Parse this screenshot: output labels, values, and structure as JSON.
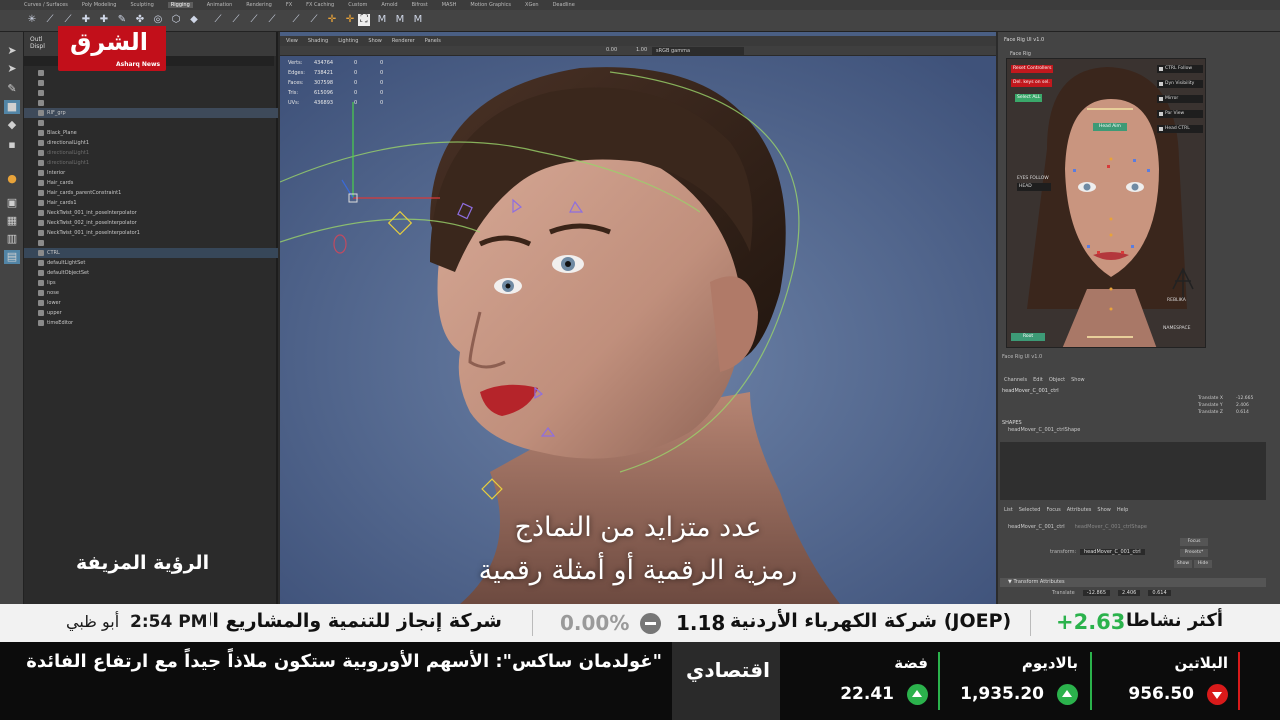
{
  "maya": {
    "shelf_tabs": [
      "Curves / Surfaces",
      "Poly Modeling",
      "Sculpting",
      "Rigging",
      "Animation",
      "Rendering",
      "FX",
      "FX Caching",
      "Custom",
      "Arnold",
      "Bifrost",
      "MASH",
      "Motion Graphics",
      "XGen",
      "Deadline"
    ],
    "active_shelf": "Rigging",
    "outliner": {
      "title": "Outl",
      "subtitle": "Displ",
      "items": [
        {
          "label": "",
          "dim": false
        },
        {
          "label": "",
          "dim": true
        },
        {
          "label": "",
          "dim": true
        },
        {
          "label": "",
          "dim": true
        },
        {
          "label": "RIF_grp",
          "dim": false,
          "sel": true
        },
        {
          "label": "",
          "dim": true
        },
        {
          "label": "Black_Plane",
          "dim": false
        },
        {
          "label": "directionalLight1",
          "dim": false
        },
        {
          "label": "directionalLight1",
          "dim": true
        },
        {
          "label": "directionalLight1",
          "dim": true
        },
        {
          "label": "Interior",
          "dim": false
        },
        {
          "label": "Hair_cards",
          "dim": false
        },
        {
          "label": "Hair_cards_parentConstraint1",
          "dim": false
        },
        {
          "label": "Hair_cards1",
          "dim": false
        },
        {
          "label": "NeckTwist_001_int_poseInterpolator",
          "dim": false
        },
        {
          "label": "NeckTwist_002_int_poseInterpolator",
          "dim": false
        },
        {
          "label": "NeckTwist_001_int_poseInterpolator1",
          "dim": false
        },
        {
          "label": "",
          "dim": true
        },
        {
          "label": "CTRL",
          "dim": false,
          "sel2": true
        },
        {
          "label": "defaultLightSet",
          "dim": false
        },
        {
          "label": "defaultObjectSet",
          "dim": false
        },
        {
          "label": "lips",
          "dim": false
        },
        {
          "label": "nose",
          "dim": false
        },
        {
          "label": "lower",
          "dim": false
        },
        {
          "label": "upper",
          "dim": false
        },
        {
          "label": "timeEditor",
          "dim": false
        }
      ]
    },
    "viewport": {
      "menu": [
        "View",
        "Shading",
        "Lighting",
        "Show",
        "Renderer",
        "Panels"
      ],
      "color_space": "sRGB gamma",
      "field_a": "0.00",
      "field_b": "1.00",
      "hud": [
        {
          "k": "Verts:",
          "v": "434764",
          "a": "0",
          "b": "0"
        },
        {
          "k": "Edges:",
          "v": "738421",
          "a": "0",
          "b": "0"
        },
        {
          "k": "Faces:",
          "v": "307598",
          "a": "0",
          "b": "0"
        },
        {
          "k": "Tris:",
          "v": "615096",
          "a": "0",
          "b": "0"
        },
        {
          "k": "UVs:",
          "v": "436893",
          "a": "0",
          "b": "0"
        }
      ]
    },
    "face_rig": {
      "title": "Face Rig UI v1.0",
      "subtitle": "Face Rig",
      "buttons": {
        "reset": "Reset Controllers",
        "del_keys": "Del. keys on sel.",
        "select_all": "Select ALL",
        "head_aim": "Head Aim",
        "root": "Root",
        "eyes_follow": "EYES FOLLOW",
        "eyes_target": "HEAD",
        "namespace": "NAMESPACE",
        "brand": "REBLIKA"
      },
      "checks": [
        "CTRL Follow",
        "Dyn Visibility",
        "Mirror",
        "Par View",
        "Head CTRL"
      ],
      "footer": "Face Rig UI v1.0"
    },
    "channel_box": {
      "menu": [
        "Channels",
        "Edit",
        "Object",
        "Show"
      ],
      "node": "headMover_C_001_ctrl",
      "attrs": [
        {
          "k": "Translate X",
          "v": "-12.665"
        },
        {
          "k": "Translate Y",
          "v": "2.406"
        },
        {
          "k": "Translate Z",
          "v": "0.614"
        }
      ],
      "shapes_label": "SHAPES",
      "shape_node": "headMover_C_001_ctrlShape"
    },
    "attr_editor": {
      "menu": [
        "List",
        "Selected",
        "Focus",
        "Attributes",
        "Show",
        "Help"
      ],
      "tabs": [
        "headMover_C_001_ctrl",
        "headMover_C_001_ctrlShape"
      ],
      "transform_label": "transform:",
      "transform_value": "headMover_C_001_ctrl",
      "focus": "Focus",
      "presets": "Presets*",
      "show": "Show",
      "hide": "Hide",
      "section": "Transform Attributes",
      "translate_label": "Translate",
      "translate": [
        "-12.865",
        "2.406",
        "0.614"
      ]
    }
  },
  "broadcast": {
    "logo_ar": "الشرق",
    "logo_en": "Asharq News",
    "watermark": "الرؤية المزيفة",
    "caption_line1": "عدد متزايد من النماذج",
    "caption_line2": "رمزية الرقمية أو أمثلة رقمية",
    "city": "أبو ظبي",
    "time": "2:54 PM",
    "ticker_name1": "شركة إنجاز للتنمية والمشاريع المتعددة",
    "ticker_pct": "0.00%",
    "ticker_price": "1.18",
    "ticker_name2": "شركة الكهرباء الأردنية (JOEP)",
    "ticker_change": "+2.63",
    "ticker_label": "أكثر نشاطا",
    "headline": "\"غولدمان ساكس\": الأسهم الأوروبية ستكون ملاذاً جيداً مع ارتفاع الفائدة",
    "section": "اقتصادي",
    "markets": [
      {
        "name": "فضة",
        "value": "22.41",
        "dir": "up"
      },
      {
        "name": "بالاديوم",
        "value": "1,935.20",
        "dir": "up"
      },
      {
        "name": "البلاتين",
        "value": "956.50",
        "dir": "down"
      }
    ],
    "colors": {
      "brand_red": "#c20f1a",
      "up_green": "#2bb24c",
      "down_red": "#d91a1a",
      "viewport_bg": "#4a5f84"
    }
  }
}
